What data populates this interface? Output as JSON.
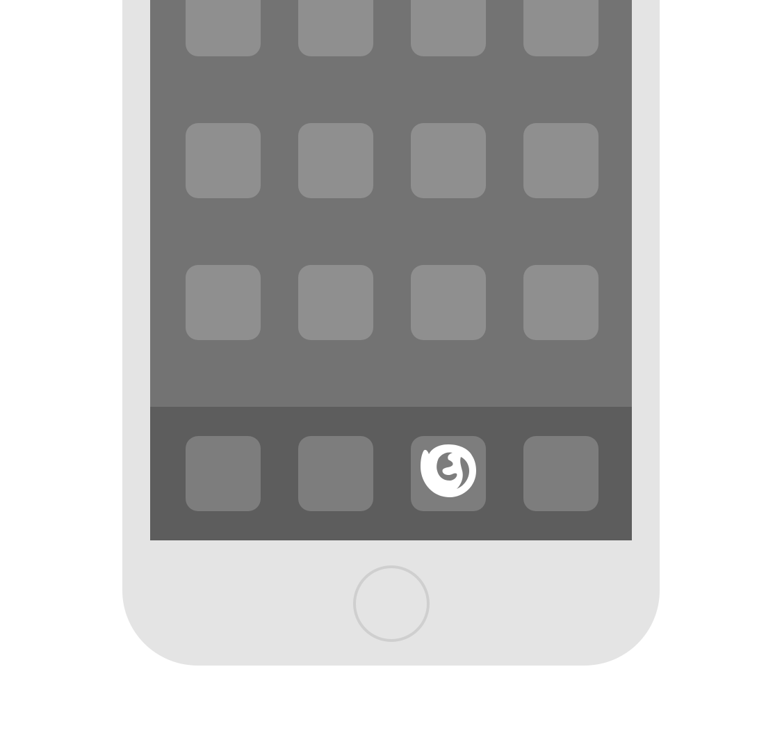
{
  "device": {
    "type": "phone-mockup",
    "frame_color": "#e4e4e4",
    "screen_color": "#737373",
    "dock_color": "#5d5d5d",
    "placeholder_icon_color": "#8f8f8f",
    "dock_icon_color": "#7d7d7d"
  },
  "home_screen": {
    "rows": 3,
    "columns": 4,
    "note_visible_text": ""
  },
  "dock": {
    "items": [
      {
        "icon": "app-placeholder-icon"
      },
      {
        "icon": "app-placeholder-icon"
      },
      {
        "icon": "firefox-icon"
      },
      {
        "icon": "app-placeholder-icon"
      }
    ]
  },
  "home_button": {
    "icon": "home-button"
  }
}
